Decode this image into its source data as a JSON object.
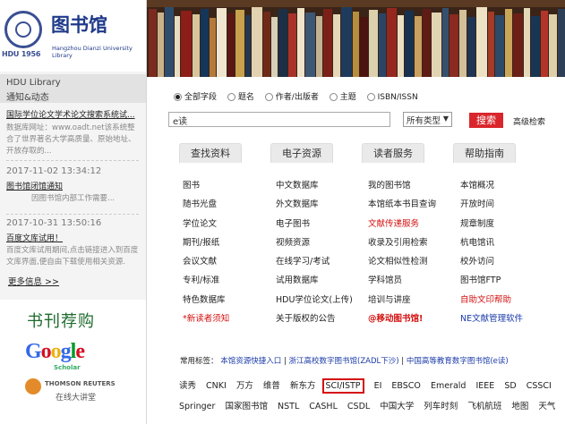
{
  "header": {
    "title": "图书馆",
    "subtitle_en": "Hangzhou Dianzi University Library",
    "seal_text": "HDU 1956"
  },
  "news": {
    "heading_en": "HDU Library",
    "heading_cn": "通知&动态",
    "items": [
      {
        "title": "国际学位论文学术论文搜索系统试...",
        "date": "",
        "desc": "数据库网址：www.oadt.net该系统整合了世界著名大学高质量、原始地址、开放存取的..."
      },
      {
        "title": "图书馆闭馆通知",
        "date": "2017-11-02 13:34:12",
        "desc": "因图书馆内部工作需要..."
      },
      {
        "title": "百度文库试用！",
        "date": "2017-10-31 13:50:16",
        "desc": "百度文库试用期间,点击链接进入到百度文库界面,便自由下载使用相关资源."
      }
    ],
    "more": "更多信息 >>"
  },
  "promo": {
    "title": "书刊荐购",
    "google": "Google",
    "google_sub": "Scholar",
    "tr": "THOMSON REUTERS",
    "tr_sub": "在线大讲堂"
  },
  "search": {
    "radios": [
      {
        "label": "全部字段",
        "checked": true
      },
      {
        "label": "题名",
        "checked": false
      },
      {
        "label": "作者/出版者",
        "checked": false
      },
      {
        "label": "主题",
        "checked": false
      },
      {
        "label": "ISBN/ISSN",
        "checked": false
      }
    ],
    "query": "e读",
    "type": "所有类型",
    "button": "搜索",
    "advanced": "高级检索"
  },
  "tabs": [
    "查找资料",
    "电子资源",
    "读者服务",
    "帮助指南"
  ],
  "columns": [
    [
      "图书",
      "随书光盘",
      "学位论文",
      "期刊/报纸",
      "会议文献",
      "专利/标准",
      "特色数据库",
      "*新读者须知"
    ],
    [
      "中文数据库",
      "外文数据库",
      "电子图书",
      "视频资源",
      "在线学习/考试",
      "试用数据库",
      "HDU学位论文(上传)",
      "关于版权的公告"
    ],
    [
      "我的图书馆",
      "本馆纸本书目查询",
      "文献传递服务",
      "收录及引用检索",
      "论文相似性检测",
      "学科馆员",
      "培训与讲座",
      "@移动图书馆!"
    ],
    [
      "本馆概况",
      "开放时间",
      "规章制度",
      "杭电馆讯",
      "校外访问",
      "图书馆FTP",
      "自助文印帮助",
      "NE文献管理软件"
    ]
  ],
  "common_tags": {
    "label": "常用标签：",
    "links": [
      "本馆资源快捷入口",
      "浙江高校数字图书馆(ZADL下沙)",
      "中国高等教育数字图书馆(e读)"
    ],
    "row1": [
      "读秀",
      "CNKI",
      "万方",
      "维普",
      "新东方",
      "SCI/ISTP",
      "EI",
      "EBSCO",
      "Emerald",
      "IEEE",
      "SD",
      "CSSCI"
    ],
    "row2": [
      "Springer",
      "国家图书馆",
      "NSTL",
      "CASHL",
      "CSDL",
      "中国大学",
      "列车时刻",
      "飞机航班",
      "地图",
      "天气"
    ]
  },
  "colors": {
    "brand_blue": "#1f3a8a",
    "accent_red": "#d9262c"
  }
}
